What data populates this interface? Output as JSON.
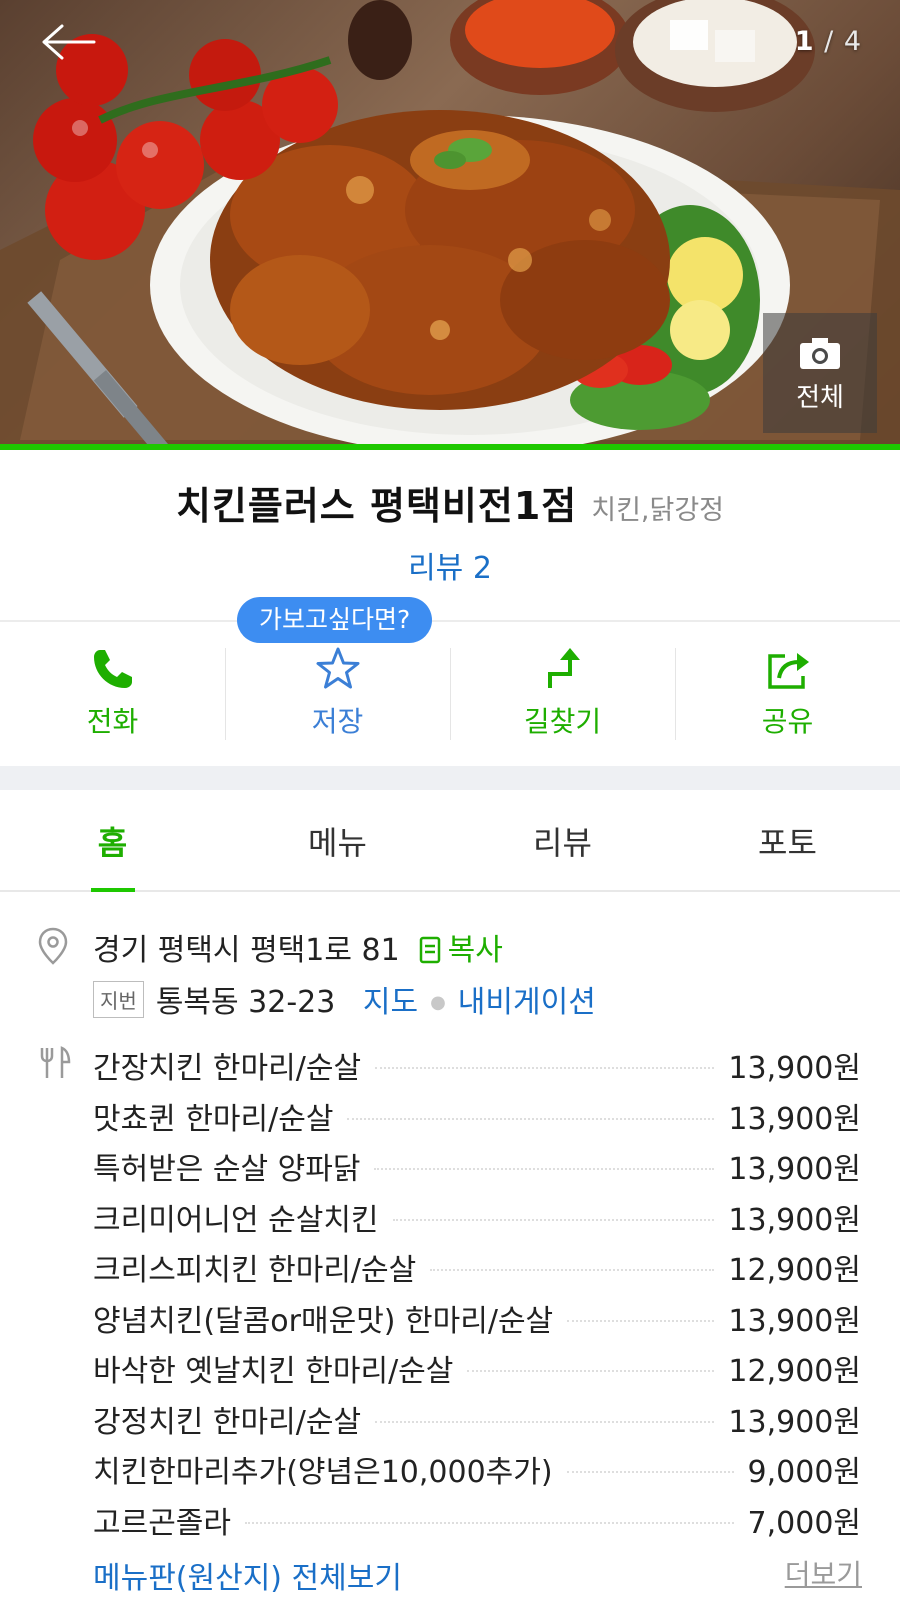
{
  "hero": {
    "counter_current": "1",
    "counter_sep": " / ",
    "counter_total": "4",
    "all_photos_label": "전체"
  },
  "place": {
    "name": "치킨플러스 평택비전1점",
    "category": "치킨,닭강정",
    "review_link": "리뷰 2"
  },
  "tooltip": "가보고싶다면?",
  "actions": [
    {
      "label": "전화",
      "icon": "phone-icon"
    },
    {
      "label": "저장",
      "icon": "star-icon"
    },
    {
      "label": "길찾기",
      "icon": "directions-icon"
    },
    {
      "label": "공유",
      "icon": "share-icon"
    }
  ],
  "tabs": [
    "홈",
    "메뉴",
    "리뷰",
    "포토"
  ],
  "address": {
    "road": "경기 평택시 평택1로 81",
    "copy_label": "복사",
    "jibeon_badge": "지번",
    "jibeon": "통복동 32-23",
    "map_link": "지도",
    "nav_link": "내비게이션"
  },
  "menu": [
    {
      "name": "간장치킨 한마리/순살",
      "price": "13,900원"
    },
    {
      "name": "맛쵸퀸 한마리/순살",
      "price": "13,900원"
    },
    {
      "name": "특허받은 순살 양파닭",
      "price": "13,900원"
    },
    {
      "name": "크리미어니언 순살치킨",
      "price": "13,900원"
    },
    {
      "name": "크리스피치킨 한마리/순살",
      "price": "12,900원"
    },
    {
      "name": "양념치킨(달콤or매운맛) 한마리/순살",
      "price": "13,900원"
    },
    {
      "name": "바삭한 옛날치킨 한마리/순살",
      "price": "12,900원"
    },
    {
      "name": "강정치킨 한마리/순살",
      "price": "13,900원"
    },
    {
      "name": "치킨한마리추가(양념은10,000추가)",
      "price": "9,000원"
    },
    {
      "name": "고르곤졸라",
      "price": "7,000원"
    }
  ],
  "menu_footer": {
    "full_menu": "메뉴판(원산지) 전체보기",
    "more": "더보기"
  },
  "colors": {
    "brand_green": "#1ec800",
    "link_blue": "#1a6fc7",
    "tooltip_blue": "#3d8df1"
  }
}
